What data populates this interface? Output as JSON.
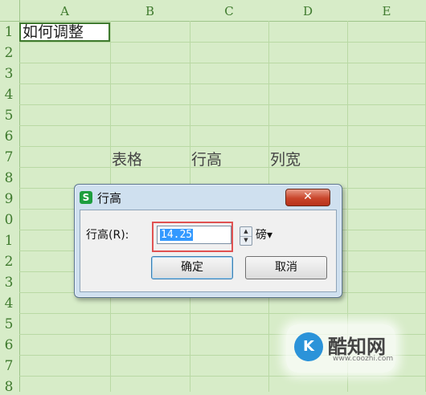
{
  "spreadsheet": {
    "columns": [
      "A",
      "B",
      "C",
      "D",
      "E"
    ],
    "rows": [
      "1",
      "2",
      "3",
      "4",
      "5",
      "6",
      "7",
      "8",
      "9",
      "0",
      "1",
      "2",
      "3",
      "4",
      "5",
      "6",
      "7",
      "8"
    ],
    "cells": {
      "A1": "如何调整",
      "B7": "表格",
      "C7": "行高",
      "D7": "列宽"
    }
  },
  "dialog": {
    "title": "行高",
    "app_icon": "wps-s-icon",
    "close_label": "✕",
    "field_label": "行高(R):",
    "value": "14.25",
    "unit": "磅▾",
    "ok_label": "确定",
    "cancel_label": "取消"
  },
  "watermark": {
    "name": "酷知网",
    "url": "www.coozhi.com"
  },
  "colors": {
    "sheet_background": "#d7ecc8",
    "header_text": "#3f7a2e",
    "highlight_frame": "#e05252",
    "selection": "#3399ff",
    "close_button": "#c9452b"
  }
}
